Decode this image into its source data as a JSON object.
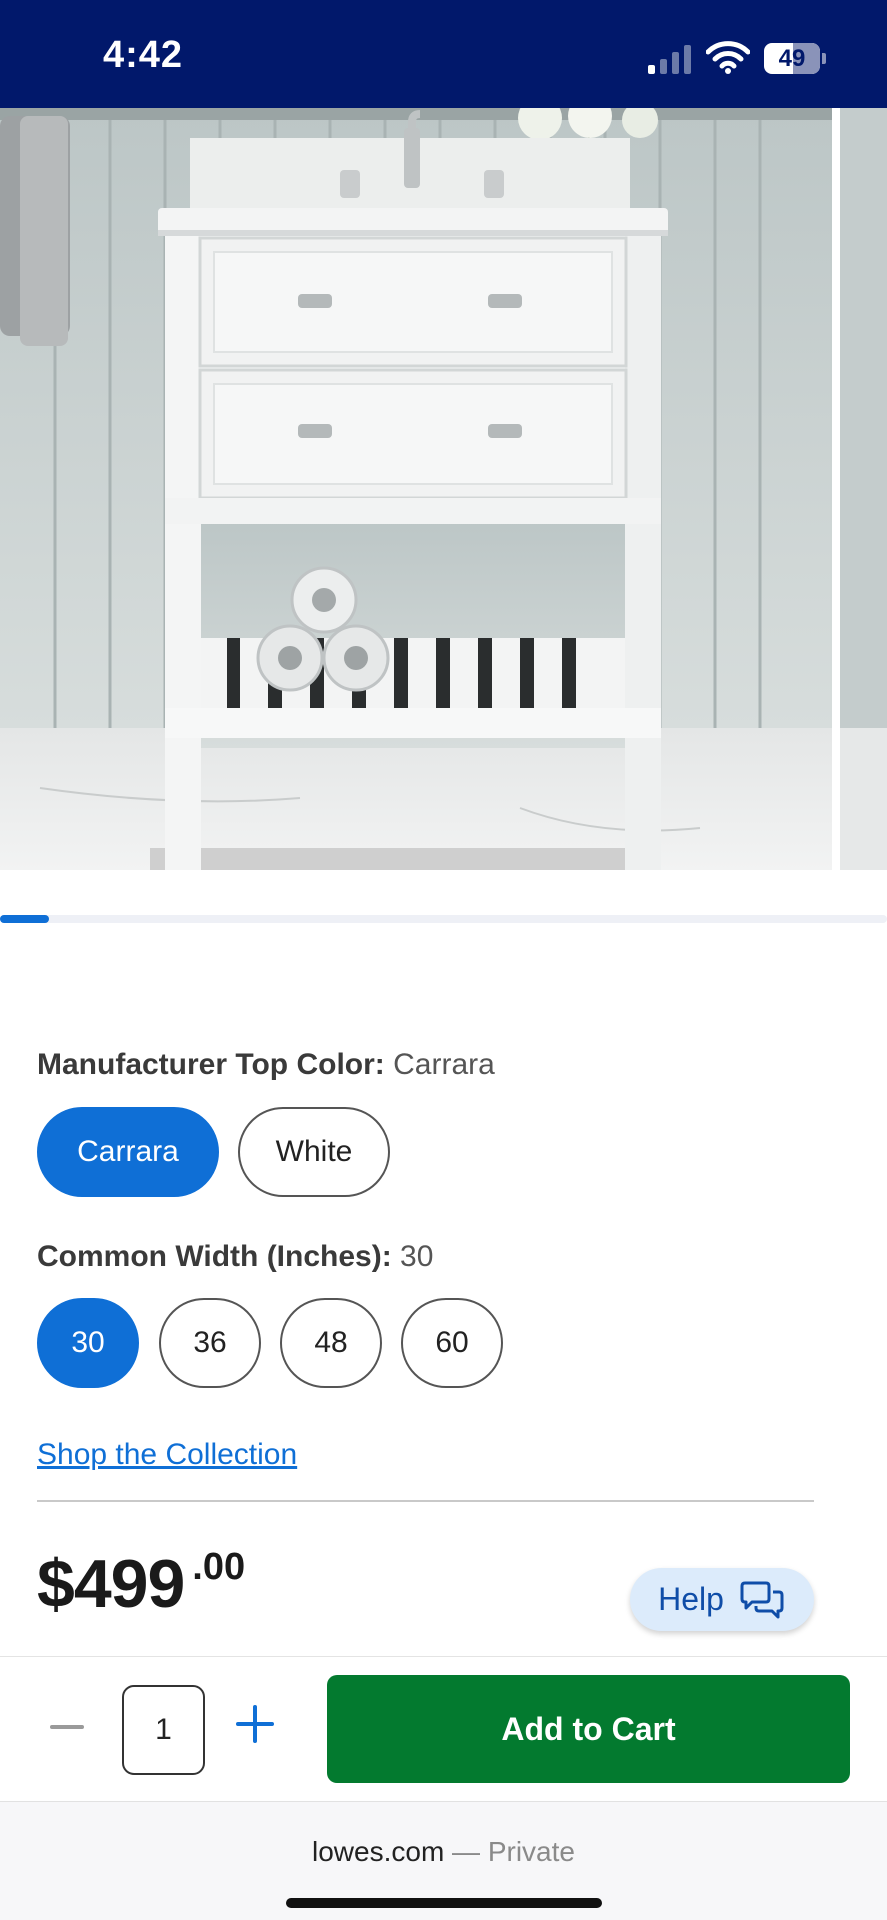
{
  "status_bar": {
    "time": "4:42",
    "battery": "49",
    "signal_bars_active": 1,
    "colors": {
      "background": "#01186b"
    }
  },
  "product_image": {
    "description_icon": "bathroom-vanity-image",
    "carousel_progress_fraction": 0.055
  },
  "options": {
    "top_color": {
      "label": "Manufacturer Top Color:",
      "selected": "Carrara",
      "choices": [
        "Carrara",
        "White"
      ]
    },
    "width": {
      "label": "Common Width (Inches):",
      "selected": "30",
      "choices": [
        "30",
        "36",
        "48",
        "60"
      ]
    }
  },
  "links": {
    "collection": "Shop the Collection"
  },
  "price": {
    "dollars": "$499",
    "cents": ".00"
  },
  "help": {
    "label": "Help",
    "icon": "chat-bubbles-icon"
  },
  "cart": {
    "quantity": "1",
    "add_label": "Add to Cart",
    "colors": {
      "button": "#037a2f",
      "accent": "#0f6fd6"
    }
  },
  "browser": {
    "domain": "lowes.com",
    "mode": "— Private"
  }
}
